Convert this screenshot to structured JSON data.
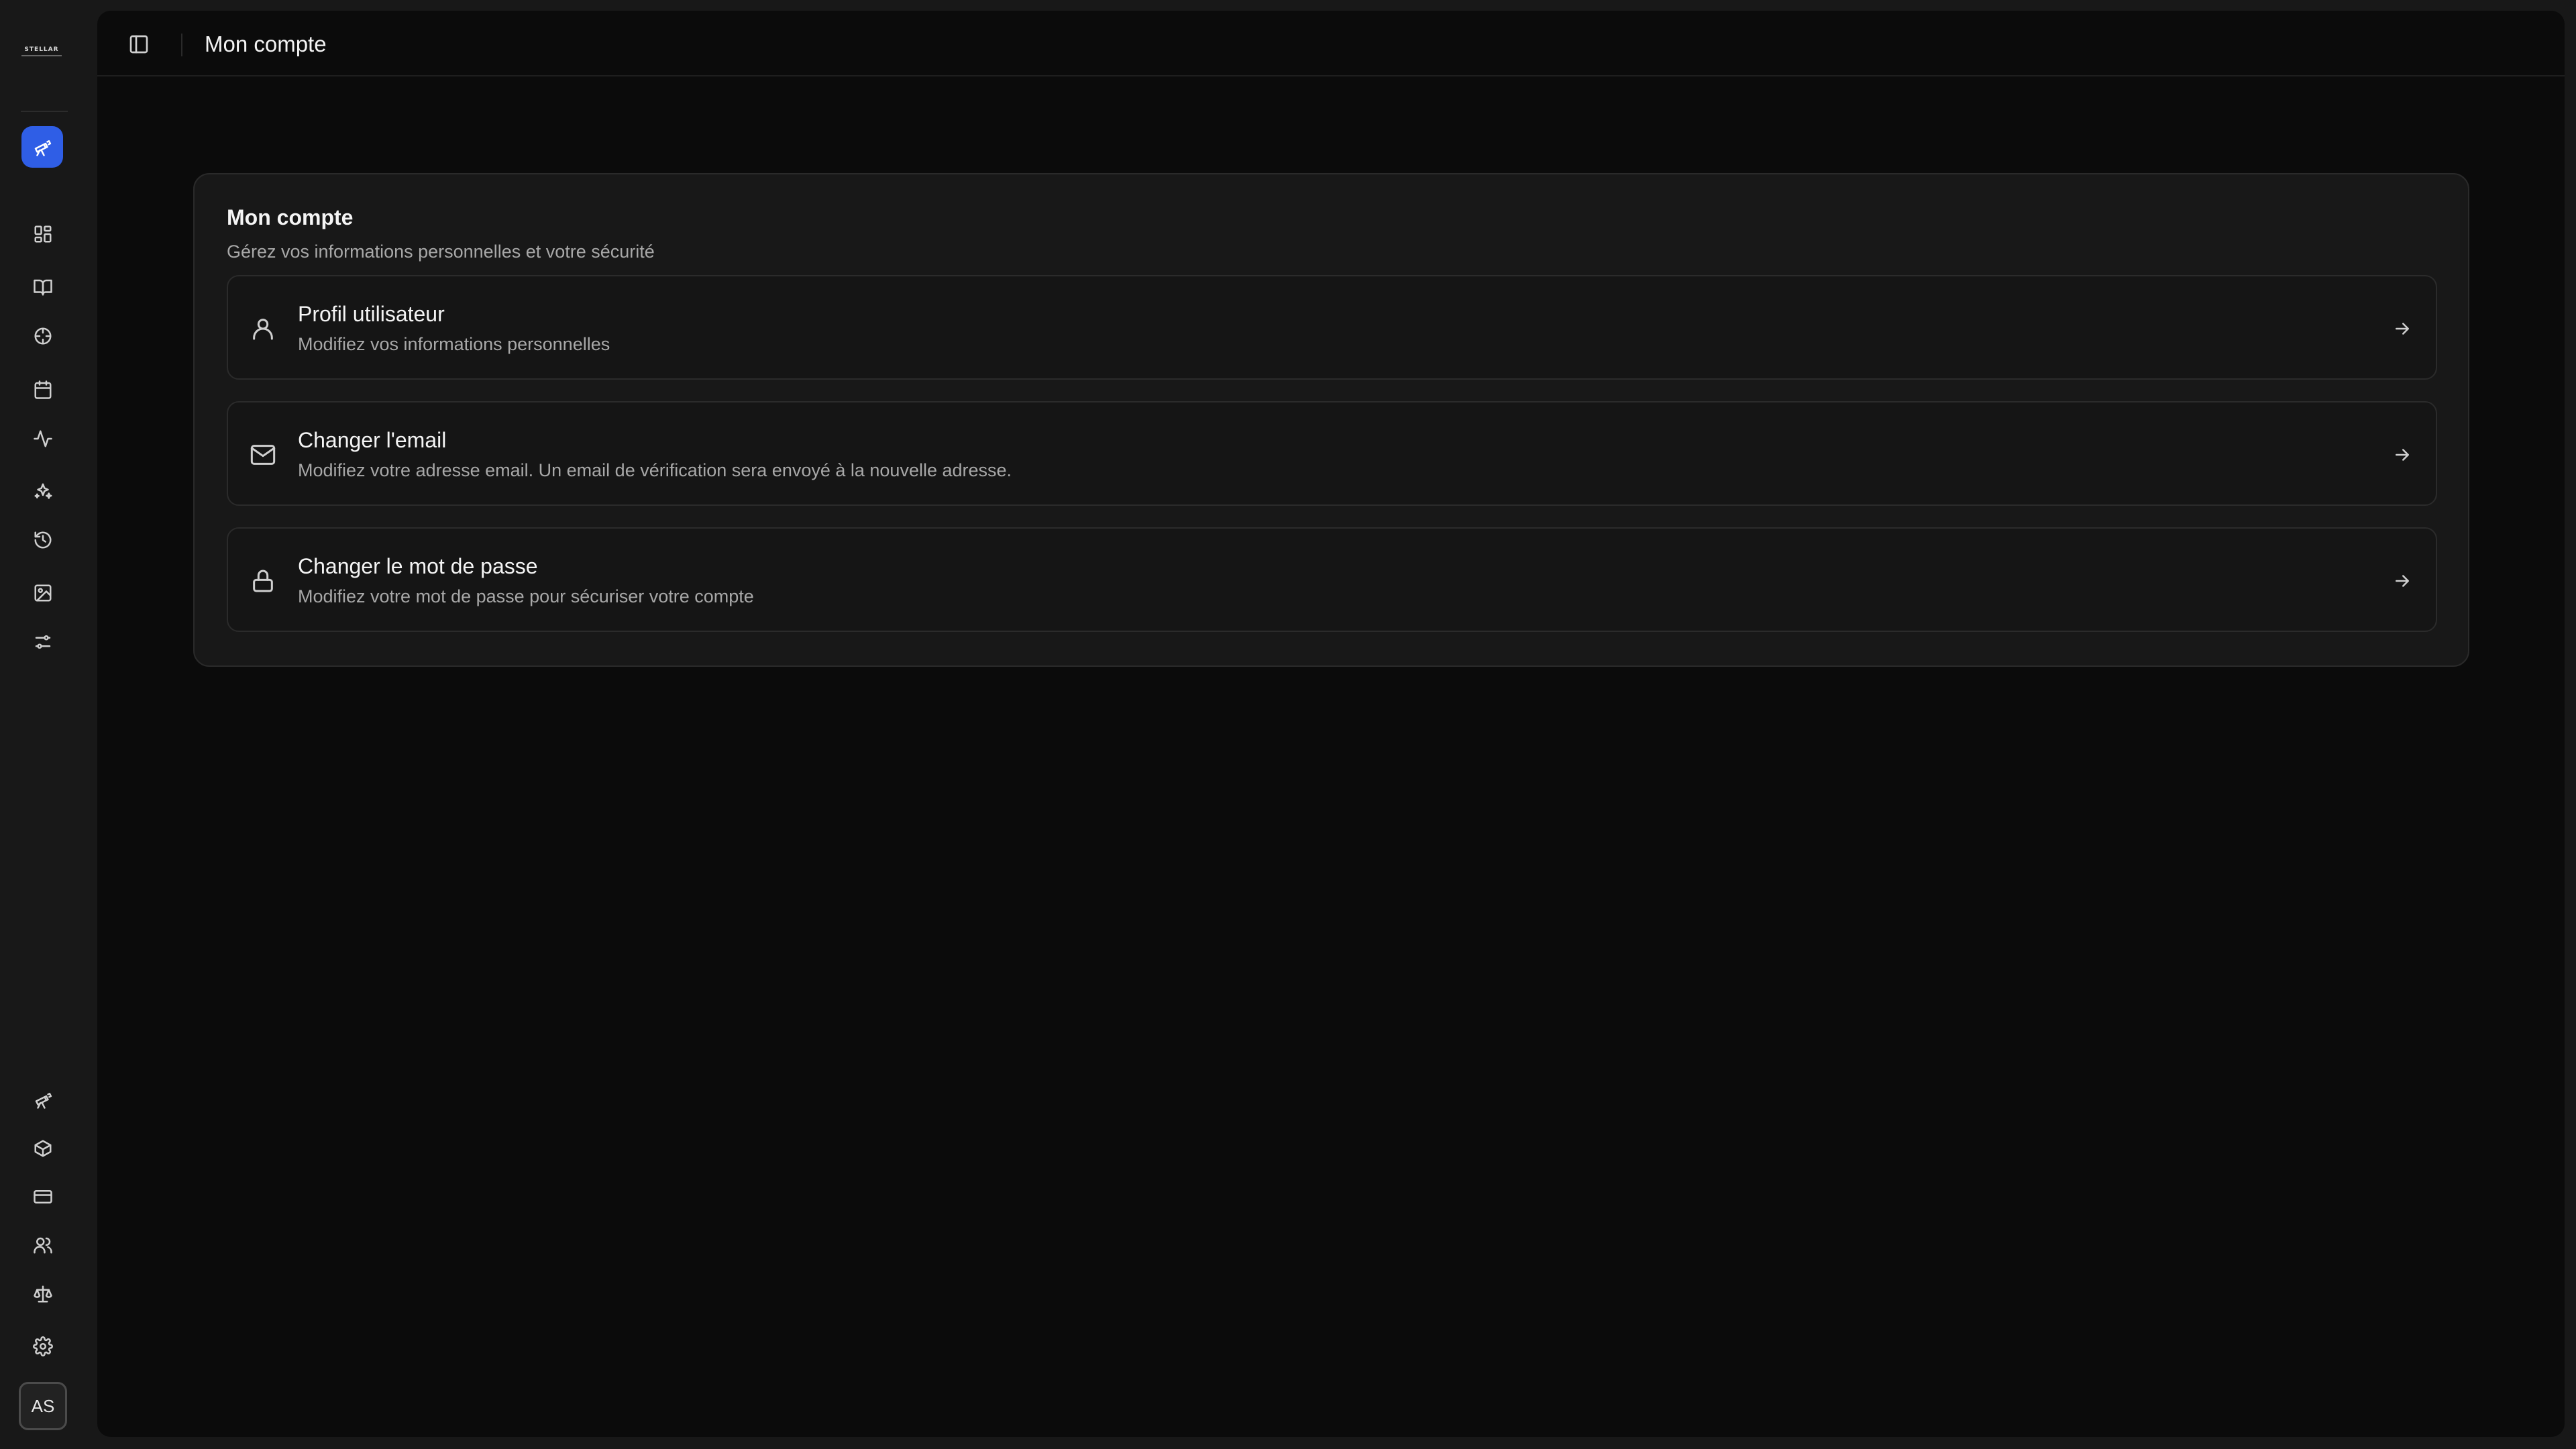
{
  "app": {
    "logo_text": "STELLAR",
    "colors": {
      "accent": "#2f5ee6",
      "background": "#0b0b0b",
      "card": "#181818"
    }
  },
  "sidebar": {
    "active_item": {
      "icon": "telescope-icon"
    },
    "nav_items": [
      {
        "icon": "dashboard-grid-icon"
      },
      {
        "icon": "book-icon"
      },
      {
        "icon": "crosshair-icon"
      },
      {
        "icon": "calendar-icon"
      },
      {
        "icon": "activity-icon"
      },
      {
        "icon": "sparkles-icon"
      },
      {
        "icon": "clock-history-icon"
      },
      {
        "icon": "image-icon"
      },
      {
        "icon": "sliders-icon"
      }
    ],
    "bottom_items": [
      {
        "icon": "telescope-icon"
      },
      {
        "icon": "package-icon"
      },
      {
        "icon": "credit-card-icon"
      },
      {
        "icon": "users-icon"
      },
      {
        "icon": "scale-icon"
      },
      {
        "icon": "settings-gear-icon"
      }
    ],
    "avatar_initials": "AS"
  },
  "header": {
    "title": "Mon compte"
  },
  "account": {
    "title": "Mon compte",
    "subtitle": "Gérez vos informations personnelles et votre sécurité",
    "options": [
      {
        "icon": "user-icon",
        "title": "Profil utilisateur",
        "description": "Modifiez vos informations personnelles"
      },
      {
        "icon": "mail-icon",
        "title": "Changer l'email",
        "description": "Modifiez votre adresse email. Un email de vérification sera envoyé à la nouvelle adresse."
      },
      {
        "icon": "lock-icon",
        "title": "Changer le mot de passe",
        "description": "Modifiez votre mot de passe pour sécuriser votre compte"
      }
    ]
  }
}
